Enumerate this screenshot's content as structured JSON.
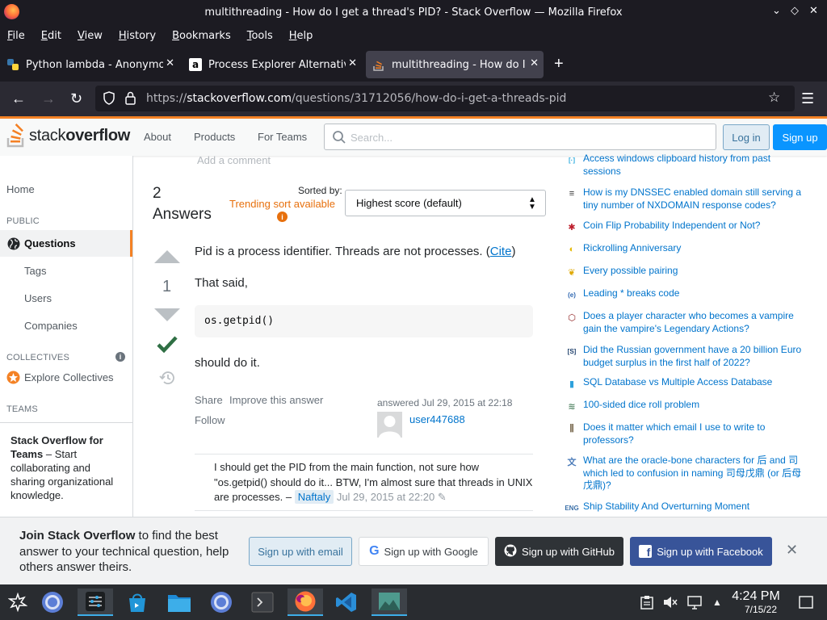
{
  "window": {
    "title": "multithreading - How do I get a thread's PID? - Stack Overflow — Mozilla Firefox"
  },
  "menu": [
    "File",
    "Edit",
    "View",
    "History",
    "Bookmarks",
    "Tools",
    "Help"
  ],
  "tabs": [
    {
      "label": "Python lambda - Anonymous",
      "icon": "python-icon"
    },
    {
      "label": "Process Explorer Alternative",
      "icon": "a-icon"
    },
    {
      "label": "multithreading - How do I",
      "icon": "stackoverflow-icon"
    }
  ],
  "url": {
    "prefix": "https://",
    "domain": "stackoverflow.com",
    "path": "/questions/31712056/how-do-i-get-a-threads-pid"
  },
  "so_header": {
    "logo_a": "stack",
    "logo_b": "overflow",
    "nav": [
      "About",
      "Products",
      "For Teams"
    ],
    "search_placeholder": "Search...",
    "login": "Log in",
    "signup": "Sign up"
  },
  "leftnav": {
    "home": "Home",
    "public": "PUBLIC",
    "questions": "Questions",
    "tags": "Tags",
    "users": "Users",
    "companies": "Companies",
    "collectives": "COLLECTIVES",
    "explore": "Explore Collectives",
    "teams": "TEAMS",
    "teams_title": "Stack Overflow for Teams",
    "teams_body": " – Start collaborating and sharing organizational knowledge."
  },
  "main": {
    "add_comment": "Add a comment",
    "answers_count": "2",
    "answers_label": "Answers",
    "sorted_by": "Sorted by:",
    "trending": "Trending sort available",
    "sort_value": "Highest score (default)",
    "vote_count": "1",
    "p1": "Pid is a process identifier. Threads are not processes. (",
    "cite": "Cite",
    "p1_end": ")",
    "p2": "That said,",
    "code": "os.getpid()",
    "p3": "should do it.",
    "share": "Share",
    "improve": "Improve this answer",
    "follow": "Follow",
    "answered": "answered Jul 29, 2015 at 22:18",
    "user": "user447688",
    "comment": "I should get the PID from the main function, not sure how \"os.getpid() should do it... BTW, I'm almost sure that threads in UNIX are processes. –",
    "comment_user": "Naftaly",
    "comment_date": "Jul 29, 2015 at 22:20"
  },
  "hot_questions": [
    {
      "title": "Access windows clipboard history from past sessions",
      "icon": "superuser-icon",
      "color": "#2eacdf"
    },
    {
      "title": "How is my DNSSEC enabled domain still serving a tiny number of NXDOMAIN response codes?",
      "icon": "serverfault-icon",
      "color": "#333333"
    },
    {
      "title": "Coin Flip Probability Independent or Not?",
      "icon": "math-icon",
      "color": "#bd1e2c"
    },
    {
      "title": "Rickrolling Anniversary",
      "icon": "codegolf-icon",
      "color": "#e5b800"
    },
    {
      "title": "Every possible pairing",
      "icon": "mathematica-icon",
      "color": "#dfa800"
    },
    {
      "title": "Leading * breaks code",
      "icon": "latex-icon",
      "color": "#2e67b1"
    },
    {
      "title": "Does a player character who becomes a vampire gain the vampire's Legendary Actions?",
      "icon": "rpg-icon",
      "color": "#8b1a1a"
    },
    {
      "title": "Did the Russian government have a 20 billion Euro budget surplus in the first half of 2022?",
      "icon": "skeptics-icon",
      "color": "#1d3f6b"
    },
    {
      "title": "SQL Database vs Multiple Access Database",
      "icon": "dba-icon",
      "color": "#2ea1dc"
    },
    {
      "title": "100-sided dice roll problem",
      "icon": "stats-icon",
      "color": "#5a8a6b"
    },
    {
      "title": "Does it matter which email I use to write to professors?",
      "icon": "academia-icon",
      "color": "#7a6b50"
    },
    {
      "title": "What are the oracle-bone characters for 后 and 司 which led to confusion in naming 司母戊鼎 (or 后母戊鼎)?",
      "icon": "chinese-icon",
      "color": "#4a7ab8"
    },
    {
      "title": "Ship Stability And Overturning Moment",
      "icon": "engineering-icon",
      "color": "#3a6fa8"
    }
  ],
  "banner": {
    "join": "Join Stack Overflow",
    "rest": " to find the best answer to your technical question, help others answer theirs.",
    "email": "Sign up with email",
    "google": "Sign up with Google",
    "github": "Sign up with GitHub",
    "facebook": "Sign up with Facebook"
  },
  "clock": {
    "time": "4:24 PM",
    "date": "7/15/22"
  }
}
